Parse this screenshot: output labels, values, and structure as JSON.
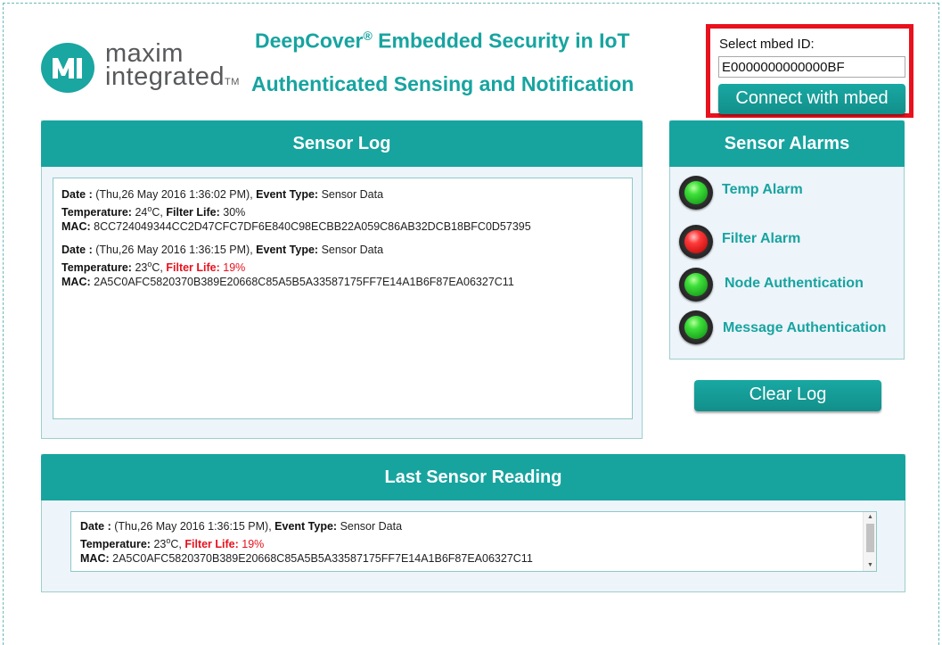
{
  "brand": {
    "line1": "maxim",
    "line2": "integrated",
    "tm": "TM",
    "accent_color": "#17a4a0"
  },
  "header": {
    "title_prefix": "DeepCover",
    "title_reg": "®",
    "title_suffix": " Embedded Security in IoT",
    "subtitle": "Authenticated Sensing and Notification"
  },
  "mbed": {
    "label": "Select mbed ID:",
    "id_value": "E0000000000000BF",
    "connect_label": "Connect with mbed",
    "highlight_color": "#e8111d"
  },
  "sensor_log": {
    "title": "Sensor Log",
    "entries": [
      {
        "date_label": "Date :",
        "date_value": " (Thu,26 May 2016 1:36:02 PM), ",
        "event_label": "Event Type:",
        "event_value": " Sensor Data",
        "temp_label": "Temperature:",
        "temp_value": " 24",
        "temp_sup": "o",
        "temp_unit": "C, ",
        "filter_label": "Filter Life:",
        "filter_value": " 30%",
        "mac_label": "MAC:",
        "mac_value": " 8CC724049344CC2D47CFC7DF6E840C98ECBB22A059C86AB32DCB18BFC0D57395"
      },
      {
        "date_label": "Date :",
        "date_value": " (Thu,26 May 2016 1:36:15 PM), ",
        "event_label": "Event Type:",
        "event_value": " Sensor Data",
        "temp_label": "Temperature:",
        "temp_value": " 23",
        "temp_sup": "o",
        "temp_unit": "C, ",
        "filter_label": "Filter Life:",
        "filter_value": " 19%",
        "mac_label": "MAC:",
        "mac_value": " 2A5C0AFC5820370B389E20668C85A5B5A33587175FF7E14A1B6F87EA06327C11"
      }
    ]
  },
  "alarms": {
    "title": "Sensor Alarms",
    "items": [
      {
        "label": "Temp Alarm",
        "status": "green"
      },
      {
        "label": "Filter Alarm",
        "status": "red"
      },
      {
        "label": "Node Authentication",
        "status": "green"
      },
      {
        "label": "Message Authentication",
        "status": "green"
      }
    ]
  },
  "clear_log_label": "Clear Log",
  "last_reading": {
    "title": "Last Sensor Reading",
    "date_label": "Date :",
    "date_value": " (Thu,26 May 2016 1:36:15 PM), ",
    "event_label": "Event Type:",
    "event_value": " Sensor Data",
    "temp_label": "Temperature:",
    "temp_value": " 23",
    "temp_sup": "o",
    "temp_unit": "C, ",
    "filter_label": "Filter Life:",
    "filter_value": " 19%",
    "mac_label": "MAC:",
    "mac_value": " 2A5C0AFC5820370B389E20668C85A5B5A33587175FF7E14A1B6F87EA06327C11"
  }
}
